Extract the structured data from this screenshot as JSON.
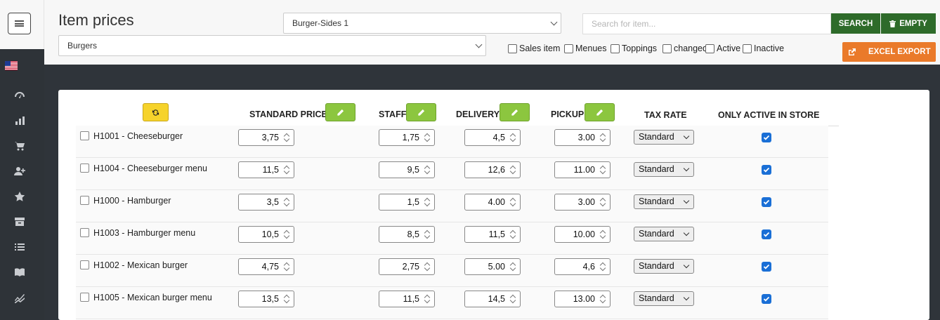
{
  "header": {
    "title": "Item prices",
    "group_select": "Burger-Sides 1",
    "category_select": "Burgers",
    "search_placeholder": "Search for item...",
    "search_label": "SEARCH",
    "empty_label": "EMPTY",
    "excel_label": "EXCEL EXPORT",
    "filters": [
      "Sales item",
      "Menues",
      "Toppings",
      "changed",
      "Active",
      "Inactive"
    ]
  },
  "sidebar": {
    "icons": [
      "menu-icon",
      "us-flag-icon",
      "dashboard-icon",
      "chart-icon",
      "cart-icon",
      "add-user-icon",
      "star-icon",
      "archive-icon",
      "list-icon",
      "book-icon",
      "trend-icon"
    ]
  },
  "table": {
    "headers": {
      "standard": "STANDARD PRICE",
      "staff": "STAFF",
      "delivery": "DELIVERY",
      "pickup": "PICKUP",
      "tax": "TAX RATE",
      "active": "ONLY ACTIVE IN STORE"
    },
    "rows": [
      {
        "name": "H1001 - Cheeseburger",
        "standard": "3,75",
        "staff": "1,75",
        "delivery": "4,5",
        "pickup": "3.00",
        "tax": "Standard",
        "active": true
      },
      {
        "name": "H1004 - Cheeseburger menu",
        "standard": "11,5",
        "staff": "9,5",
        "delivery": "12,6",
        "pickup": "11.00",
        "tax": "Standard",
        "active": true
      },
      {
        "name": "H1000 - Hamburger",
        "standard": "3,5",
        "staff": "1,5",
        "delivery": "4.00",
        "pickup": "3.00",
        "tax": "Standard",
        "active": true
      },
      {
        "name": "H1003 - Hamburger menu",
        "standard": "10,5",
        "staff": "8,5",
        "delivery": "11,5",
        "pickup": "10.00",
        "tax": "Standard",
        "active": true
      },
      {
        "name": "H1002 - Mexican burger",
        "standard": "4,75",
        "staff": "2,75",
        "delivery": "5.00",
        "pickup": "4,6",
        "tax": "Standard",
        "active": true
      },
      {
        "name": "H1005 - Mexican burger menu",
        "standard": "13,5",
        "staff": "11,5",
        "delivery": "14,5",
        "pickup": "13.00",
        "tax": "Standard",
        "active": true
      }
    ]
  },
  "colors": {
    "sidebar_bg": "#2e3338",
    "green_button": "#2e6b2a",
    "orange_button": "#ea7a2a",
    "edit_button": "#8cc63f",
    "refresh_button": "#f6d32b",
    "checkbox_checked": "#1a6fd6"
  }
}
